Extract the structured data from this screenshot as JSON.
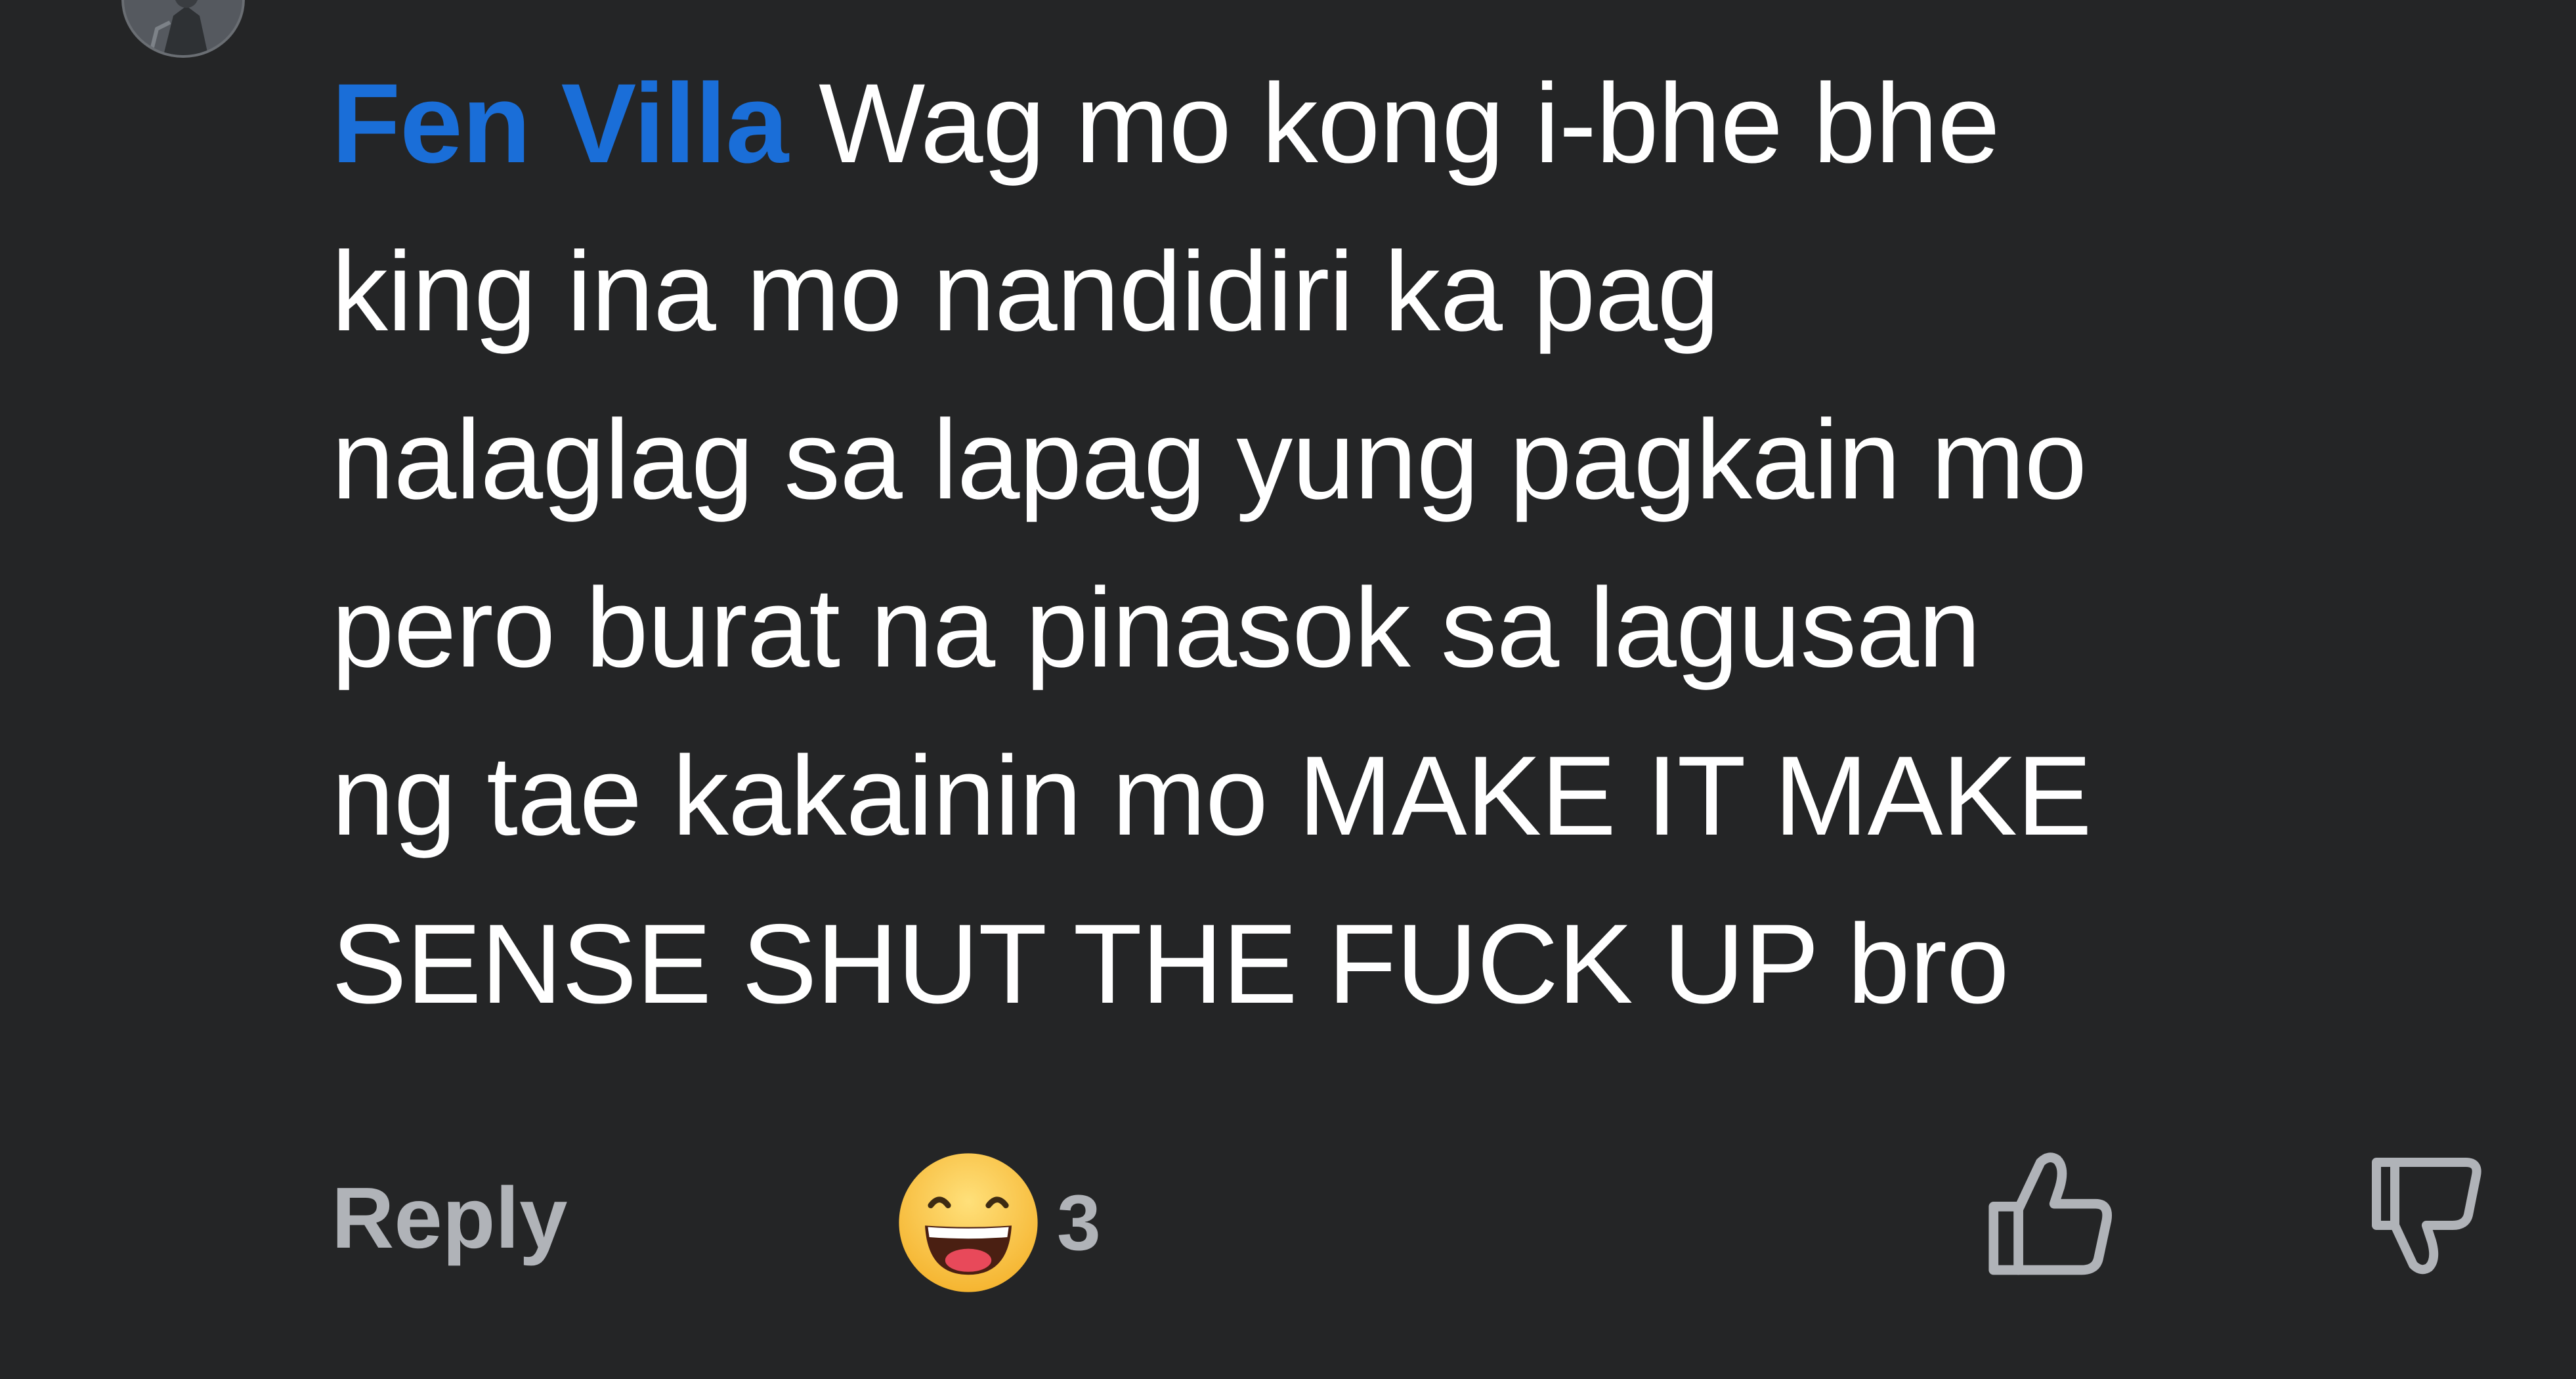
{
  "comment": {
    "author": "Fen Villa",
    "lines": [
      " Wag mo kong i-bhe bhe",
      "king ina mo nandidiri ka pag",
      "nalaglag sa lapag yung pagkain mo",
      "pero burat na pinasok sa lagusan",
      "ng tae kakainin mo MAKE IT MAKE",
      "SENSE SHUT THE FUCK UP bro"
    ]
  },
  "actions": {
    "reply_label": "Reply",
    "reaction_icon": "haha-emoji-icon",
    "reaction_count": "3",
    "like_icon": "thumbs-up-icon",
    "dislike_icon": "thumbs-down-icon"
  },
  "colors": {
    "background": "#242526",
    "author": "#1a6ed8",
    "text": "#ffffff",
    "secondary": "#b0b3b8"
  }
}
